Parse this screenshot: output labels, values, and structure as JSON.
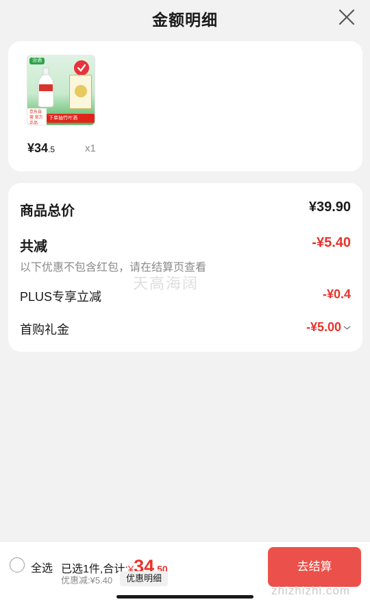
{
  "header": {
    "title": "金额明细",
    "close_icon": "close-icon"
  },
  "product": {
    "image_icon": "product-image",
    "image_text": {
      "logo": "汾酒",
      "jd_tag": "京东自营 官方正品",
      "bottom_bar": "下单抽竹叶酒"
    },
    "price_int": "¥34",
    "price_dec": ".5",
    "quantity": "x1"
  },
  "summary": {
    "total_label": "商品总价",
    "total_value": "¥39.90",
    "reduce_label": "共减",
    "reduce_value": "-¥5.40",
    "note": "以下优惠不包含红包，请在结算页查看",
    "plus_label": "PLUS专享立减",
    "plus_value": "-¥0.4",
    "gift_label": "首购礼金",
    "gift_value": "-¥5.00"
  },
  "watermark": "天高海阔",
  "bottom_bar": {
    "select_all": "全选",
    "selected_text": "已选1件,合计:",
    "yen": "¥",
    "amount_int": "34",
    "amount_dec": ".50",
    "discount_text": "优惠减:¥5.40",
    "detail_button": "优惠明细",
    "checkout_button": "去结算",
    "site_watermark": "zhizhizhi.com"
  },
  "colors": {
    "accent": "#e8332b",
    "background": "#f2f2f2",
    "card": "#ffffff",
    "muted": "#8a8a8a"
  }
}
